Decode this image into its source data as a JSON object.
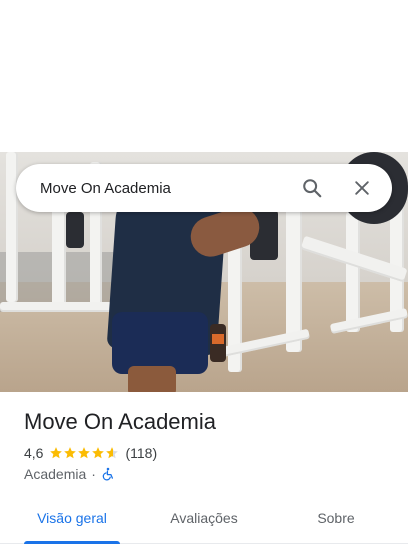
{
  "search": {
    "query": "Move On Academia"
  },
  "place": {
    "name": "Move On Academia",
    "rating": "4,6",
    "rating_value": 4.6,
    "reviews": "(118)",
    "category": "Academia",
    "separator": "·"
  },
  "tabs": [
    {
      "label": "Visão geral",
      "active": true
    },
    {
      "label": "Avaliações",
      "active": false
    },
    {
      "label": "Sobre",
      "active": false
    }
  ],
  "colors": {
    "accent": "#1a73e8",
    "star": "#fbbc04",
    "text": "#202124",
    "secondary": "#5f6368"
  },
  "icons": [
    "search-icon",
    "close-icon",
    "star-icon",
    "wheelchair-icon"
  ]
}
